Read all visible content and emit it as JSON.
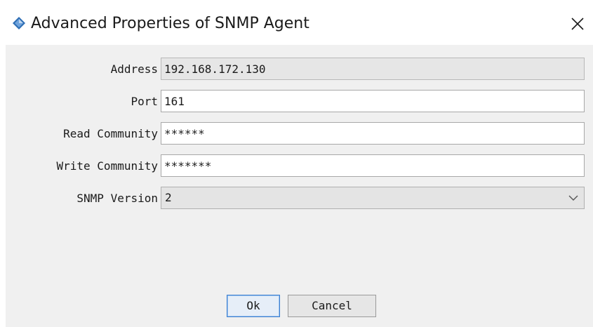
{
  "window": {
    "title": "Advanced Properties of SNMP Agent",
    "icon": "diamond-app-icon",
    "close_icon": "close-icon"
  },
  "form": {
    "address": {
      "label": "Address",
      "value": "192.168.172.130"
    },
    "port": {
      "label": "Port",
      "value": "161"
    },
    "read_community": {
      "label": "Read Community",
      "value": "******"
    },
    "write_community": {
      "label": "Write Community",
      "value": "*******"
    },
    "snmp_version": {
      "label": "SNMP Version",
      "value": "2"
    }
  },
  "buttons": {
    "ok": "Ok",
    "cancel": "Cancel"
  },
  "colors": {
    "dialog_bg": "#f0f0f0",
    "field_border": "#a8a8a8",
    "default_button_border": "#3c7fd0",
    "icon_blue": "#2f6fb5"
  }
}
